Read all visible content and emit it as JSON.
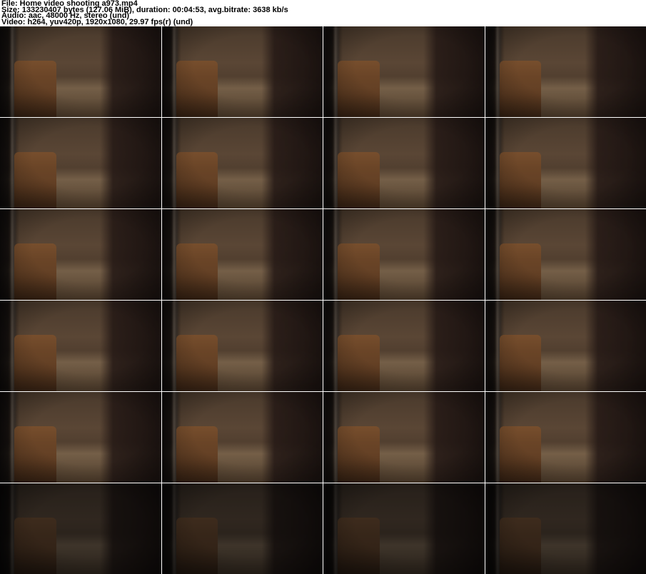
{
  "header": {
    "file_line": "File: Home video shooting a973.mp4",
    "size_line": "Size: 133230407 bytes (127.06 MiB), duration: 00:04:53, avg.bitrate: 3638 kb/s",
    "audio_line": "Audio: aac, 48000 Hz, stereo (und)",
    "video_line": "Video: h264, yuv420p, 1920x1080, 29.97 fps(r) (und)"
  },
  "grid": {
    "columns": 4,
    "rows": 6,
    "total_thumbnails": 24,
    "dark_rows": [
      5
    ]
  },
  "palette": {
    "page_background": "#ffffff",
    "header_text": "#000000",
    "room_wall": "#5a4635",
    "room_shadow": "#1a1210",
    "sofa": "#7a4f2c",
    "cloth": "#b89a77"
  }
}
